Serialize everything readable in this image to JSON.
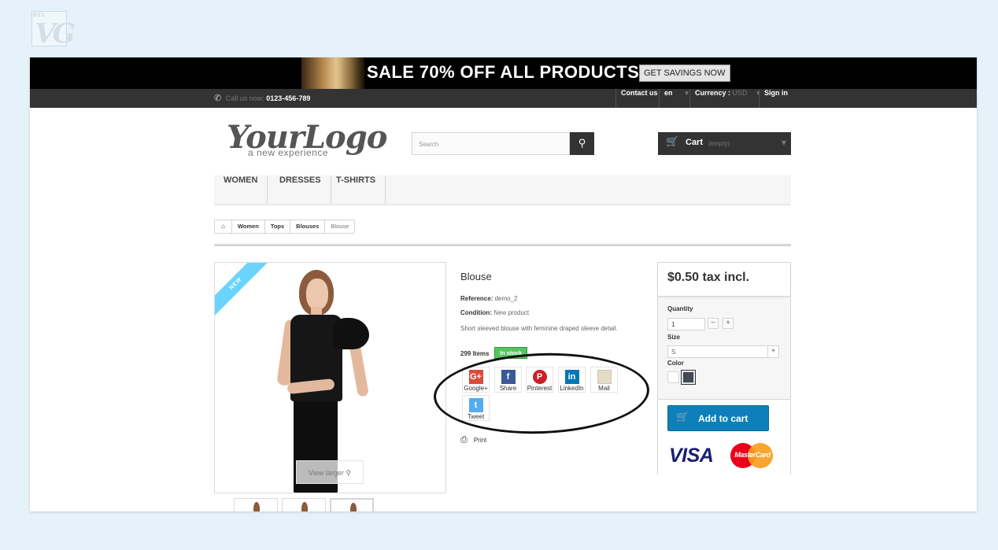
{
  "watermark": {
    "text": "BEL",
    "logo": "VG"
  },
  "banner": {
    "headline": "SALE 70% OFF ALL PRODUCTS",
    "cta": "GET SAVINGS NOW"
  },
  "topnav": {
    "phone_label": "Call us now:",
    "phone_number": "0123-456-789",
    "contact": "Contact us",
    "language": "en",
    "currency_label": "Currency :",
    "currency_value": "USD",
    "signin": "Sign in"
  },
  "header": {
    "logo_main": "YourLogo",
    "logo_tagline": "a new experience",
    "search_placeholder": "Search",
    "cart_label": "Cart",
    "cart_status": "(empty)"
  },
  "menu": [
    "WOMEN",
    "DRESSES",
    "T-SHIRTS"
  ],
  "breadcrumb": [
    "Women",
    "Tops",
    "Blouses",
    "Blouse"
  ],
  "product": {
    "badge": "NEW",
    "view_larger": "View larger",
    "title": "Blouse",
    "reference_label": "Reference:",
    "reference_value": "demo_2",
    "condition_label": "Condition:",
    "condition_value": "New product",
    "description": "Short sleeved blouse with feminine draped sleeve detail.",
    "quantity_text": "299 Items",
    "stock_status": "In stock",
    "print": "Print"
  },
  "share": [
    {
      "label": "Google+",
      "icon": "google-plus-icon",
      "color": "#dd4b39",
      "glyph": "G+"
    },
    {
      "label": "Share",
      "icon": "facebook-icon",
      "color": "#3b5998",
      "glyph": "f"
    },
    {
      "label": "Pinterest",
      "icon": "pinterest-icon",
      "color": "#cb2027",
      "glyph": "P"
    },
    {
      "label": "LinkedIn",
      "icon": "linkedin-icon",
      "color": "#0077b5",
      "glyph": "in"
    },
    {
      "label": "Mail",
      "icon": "mail-icon",
      "color": "#e4dcc6",
      "glyph": ""
    },
    {
      "label": "Tweet",
      "icon": "twitter-icon",
      "color": "#55acee",
      "glyph": "t"
    }
  ],
  "buy_box": {
    "price": "$0.50 tax incl.",
    "quantity_label": "Quantity",
    "quantity_value": "1",
    "size_label": "Size",
    "size_value": "S",
    "color_label": "Color",
    "colors": [
      "#ffffff",
      "#434a54"
    ],
    "add_to_cart": "Add to cart",
    "card_visa": "VISA",
    "card_mc": "MasterCard"
  }
}
